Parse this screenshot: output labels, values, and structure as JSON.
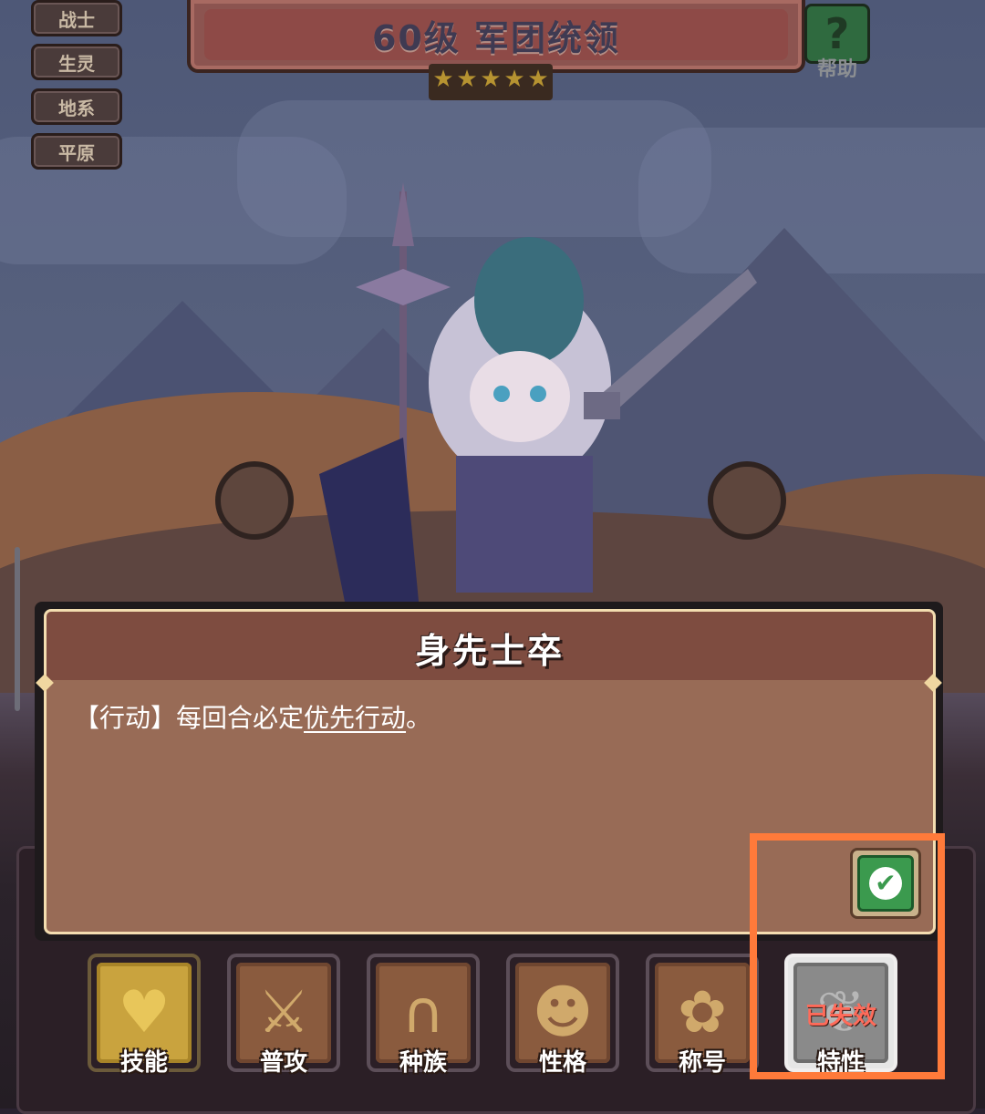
{
  "tags": [
    "战士",
    "生灵",
    "地系",
    "平原"
  ],
  "header": {
    "title": "60级  军团统领",
    "stars": 5,
    "star_glyph": "★"
  },
  "help": {
    "icon_glyph": "?",
    "label": "帮助"
  },
  "dialog": {
    "title": "身先士卒",
    "desc_prefix": "【行动】每回合必定",
    "desc_link": "优先行动",
    "desc_suffix": "。"
  },
  "confirm": {
    "icon": "check-icon",
    "glyph": "✔"
  },
  "tabs": [
    {
      "label": "技能",
      "icon": "heart-shield-icon",
      "glyph": "♥",
      "state": "active"
    },
    {
      "label": "普攻",
      "icon": "sword-icon",
      "glyph": "⚔",
      "state": "normal"
    },
    {
      "label": "种族",
      "icon": "horseshoe-icon",
      "glyph": "∩",
      "state": "normal"
    },
    {
      "label": "性格",
      "icon": "mask-icon",
      "glyph": "☻",
      "state": "normal"
    },
    {
      "label": "称号",
      "icon": "crest-icon",
      "glyph": "✿",
      "state": "normal"
    },
    {
      "label": "特性",
      "icon": "wing-icon",
      "glyph": "❦",
      "state": "trait",
      "overlay": "已失效"
    }
  ],
  "colors": {
    "highlight": "#ff7a3a",
    "expired_text": "#ff6b5a",
    "active_tab": "#c9a33e"
  }
}
